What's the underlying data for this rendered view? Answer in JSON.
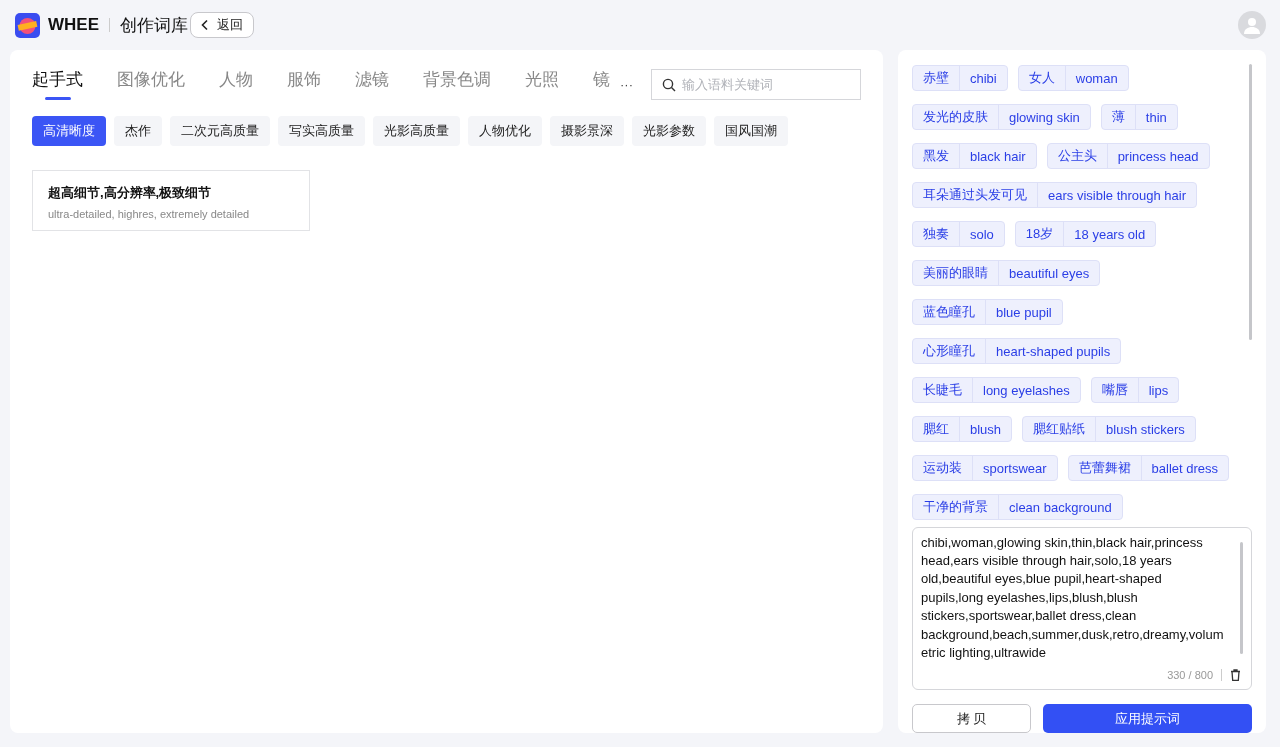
{
  "header": {
    "brand": "WHEE",
    "title": "创作词库",
    "back_button": "返回"
  },
  "categories": [
    {
      "label": "起手式",
      "selected": true
    },
    {
      "label": "图像优化",
      "selected": false
    },
    {
      "label": "人物",
      "selected": false
    },
    {
      "label": "服饰",
      "selected": false
    },
    {
      "label": "滤镜",
      "selected": false
    },
    {
      "label": "背景色调",
      "selected": false
    },
    {
      "label": "光照",
      "selected": false
    },
    {
      "label": "镜",
      "selected": false
    }
  ],
  "more": "···",
  "search": {
    "placeholder": "输入语料关键词"
  },
  "subcategories": [
    {
      "label": "高清晰度",
      "selected": true
    },
    {
      "label": "杰作",
      "selected": false
    },
    {
      "label": "二次元高质量",
      "selected": false
    },
    {
      "label": "写实高质量",
      "selected": false
    },
    {
      "label": "光影高质量",
      "selected": false
    },
    {
      "label": "人物优化",
      "selected": false
    },
    {
      "label": "摄影景深",
      "selected": false
    },
    {
      "label": "光影参数",
      "selected": false
    },
    {
      "label": "国风国潮",
      "selected": false
    }
  ],
  "phrases": [
    {
      "title": "超高细节,高分辨率,极致细节",
      "english": "ultra-detailed, highres, extremely detailed"
    }
  ],
  "selected_tags": [
    {
      "zh": "赤壁",
      "en": "chibi"
    },
    {
      "zh": "女人",
      "en": "woman"
    },
    {
      "zh": "发光的皮肤",
      "en": "glowing skin"
    },
    {
      "zh": "薄",
      "en": "thin"
    },
    {
      "zh": "黑发",
      "en": "black hair"
    },
    {
      "zh": "公主头",
      "en": "princess head"
    },
    {
      "zh": "耳朵通过头发可见",
      "en": "ears visible through hair"
    },
    {
      "zh": "独奏",
      "en": "solo"
    },
    {
      "zh": "18岁",
      "en": "18 years old"
    },
    {
      "zh": "美丽的眼睛",
      "en": "beautiful eyes"
    },
    {
      "zh": "蓝色瞳孔",
      "en": "blue pupil"
    },
    {
      "zh": "心形瞳孔",
      "en": "heart-shaped pupils"
    },
    {
      "zh": "长睫毛",
      "en": "long eyelashes"
    },
    {
      "zh": "嘴唇",
      "en": "lips"
    },
    {
      "zh": "腮红",
      "en": "blush"
    },
    {
      "zh": "腮红贴纸",
      "en": "blush stickers"
    },
    {
      "zh": "运动装",
      "en": "sportswear"
    },
    {
      "zh": "芭蕾舞裙",
      "en": "ballet dress"
    },
    {
      "zh": "干净的背景",
      "en": "clean background"
    }
  ],
  "prompt": {
    "value": "chibi,woman,glowing skin,thin,black hair,princess head,ears visible through hair,solo,18 years old,beautiful eyes,blue pupil,heart-shaped pupils,long eyelashes,lips,blush,blush stickers,sportswear,ballet dress,clean background,beach,summer,dusk,retro,dreamy,volumetric lighting,ultrawide",
    "count": "330 / 800"
  },
  "buttons": {
    "copy": "拷 贝",
    "apply": "应用提示词"
  }
}
